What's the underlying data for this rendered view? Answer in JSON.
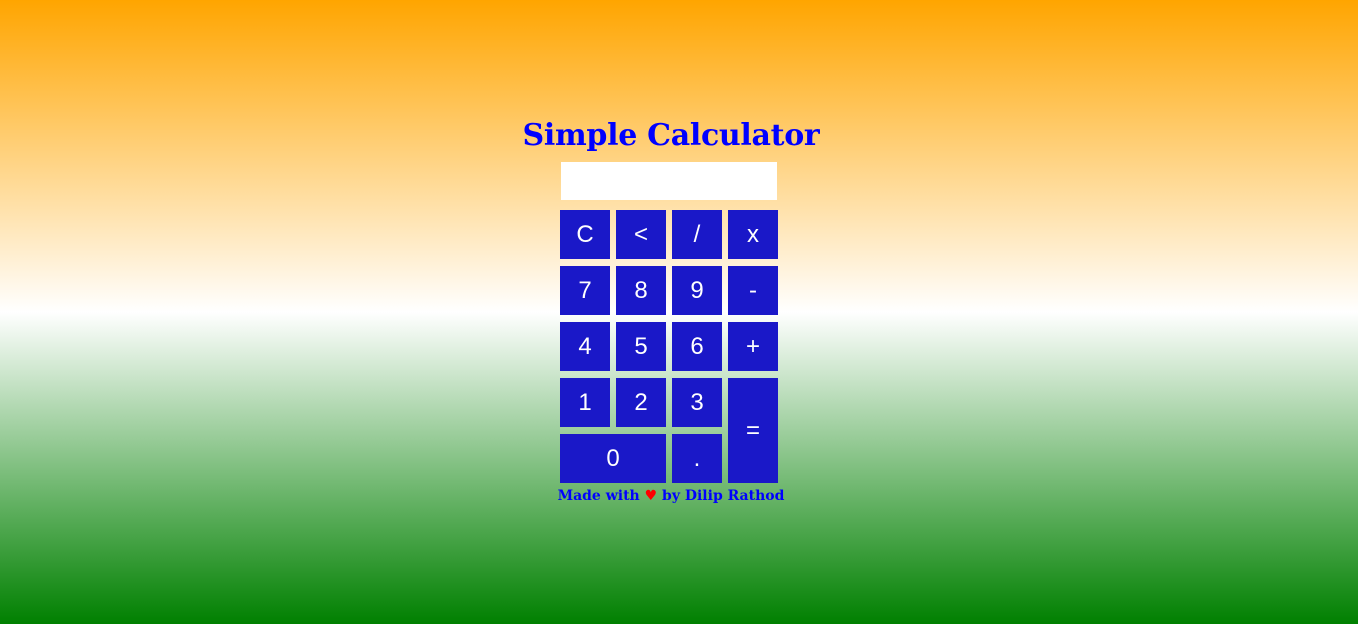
{
  "title": "Simple Calculator",
  "display": {
    "value": ""
  },
  "keys": {
    "clear": "C",
    "backspace": "<",
    "divide": "/",
    "multiply": "x",
    "seven": "7",
    "eight": "8",
    "nine": "9",
    "minus": "-",
    "four": "4",
    "five": "5",
    "six": "6",
    "plus": "+",
    "one": "1",
    "two": "2",
    "three": "3",
    "equals": "=",
    "zero": "0",
    "dot": "."
  },
  "footer": {
    "prefix": "Made with",
    "heart": "♥",
    "suffix": "by Dilip Rathod"
  },
  "colors": {
    "top": "#ffa500",
    "middle": "#ffffff",
    "bottom": "#008000",
    "button": "#1a18c8",
    "title": "#0000ff",
    "heart": "#ff0000"
  }
}
